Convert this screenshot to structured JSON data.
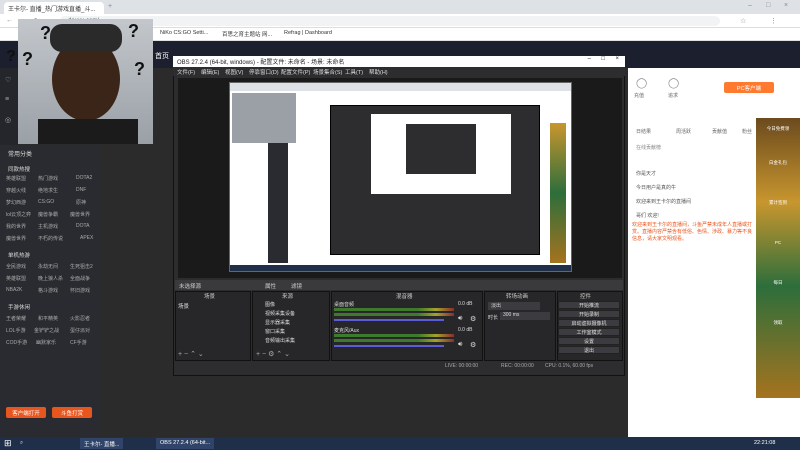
{
  "browser": {
    "tabs": [
      "王卡尔- 直播_热门游戏直播_斗..."
    ],
    "url": "douyu.com/...",
    "bookmarks": [
      "NiKo CS:GO Setti...",
      "百思之育主题站 网...",
      "Refrag | Dashboard"
    ]
  },
  "site": {
    "top_link": "首页",
    "left_menu": {
      "header": "常用分类",
      "section1": "同款热搜",
      "rows1": [
        [
          "英雄联盟",
          "热门游戏",
          "DOTA2"
        ],
        [
          "穿越火线",
          "绝地求生",
          "DNF"
        ],
        [
          "梦幻西游",
          "CS:GO",
          "原神"
        ],
        [
          "lol云顶之弈",
          "魔兽争霸",
          "魔兽世界"
        ],
        [
          "我的世界",
          "主机游戏",
          "DOTA"
        ],
        [
          "魔兽世界",
          "不朽的传说",
          "APEX"
        ]
      ],
      "section2": "单机热游",
      "rows2": [
        [
          "全民游戏",
          "永劫无间",
          "生死狙击2"
        ],
        [
          "英雄联盟",
          "晚上狼人杀",
          "全面战争"
        ],
        [
          "NBA2K",
          "格斗游戏",
          "怀旧游戏"
        ]
      ],
      "section3": "手游休闲",
      "rows3": [
        [
          "王者荣耀",
          "和平精英",
          "火影忍者"
        ],
        [
          "LOL手游",
          "金铲铲之战",
          "蛋仔派对"
        ],
        [
          "COD手游",
          "幽默家乐",
          "CF手游"
        ]
      ],
      "btn_a": "客户端打开",
      "btn_b": "斗鱼打赏"
    },
    "right": {
      "user_links": [
        "充值",
        "追求"
      ],
      "pc_badge": "PC客户端",
      "tabs": [
        "日结果",
        "周活跃",
        "贡献值",
        "粉丝"
      ],
      "gift_title": "在线贡献榜",
      "chat_lines": [
        "你是天才",
        "今日用户是真的牛",
        "欢迎来到王卡尔的直播间",
        "哥们 欢迎!",
        "最好的小嘟哥"
      ],
      "notice": "欢迎来到王卡尔的直播间，斗鱼严禁未成年人直播或打赏。直播内容严禁含有低俗、色情、涉政、暴力等不良信息，请大家文明观看。"
    },
    "promo": [
      "今日免费领",
      "白金礼包",
      "累计签到",
      "PC",
      "每日",
      "领取"
    ]
  },
  "obs": {
    "title": "OBS 27.2.4 (64-bit, windows) - 配置文件: 未命名 - 场景: 未命名",
    "menu": [
      "文件(F)",
      "编辑(E)",
      "视图(V)",
      "停靠窗口(D)",
      "配置文件(P)",
      "场景集合(S)",
      "工具(T)",
      "帮助(H)"
    ],
    "source_bar": "未选择源",
    "source_bar_btns": [
      "属性",
      "滤镜"
    ],
    "docks": [
      "场景",
      "来源",
      "混音器",
      "转场动画",
      "控件"
    ],
    "scene_item": "场景",
    "sources": [
      "图像",
      "视频采集设备",
      "显示器采集",
      "窗口采集",
      "音频输出采集"
    ],
    "mixer": [
      {
        "name": "桌面音频",
        "db": "0.0 dB"
      },
      {
        "name": "麦克风/Aux",
        "db": "0.0 dB"
      }
    ],
    "transition": {
      "type": "淡出",
      "duration_label": "时长",
      "duration": "300 ms"
    },
    "controls": [
      "开始推流",
      "开始录制",
      "启动虚拟摄像机",
      "工作室模式",
      "设置",
      "退出"
    ],
    "status": {
      "live": "LIVE: 00:00:00",
      "rec": "REC: 00:00:00",
      "cpu": "CPU: 0.1%, 60.00 fps"
    }
  },
  "taskbar": {
    "items": [
      "王卡尔- 直播...",
      "OBS 27.2.4 (64-bit..."
    ],
    "time": "22:21:08"
  },
  "colors": {
    "obs_bg": "#2d2d30",
    "taskbar": "#1f2f4a",
    "douyu_orange": "#ff7a2f"
  }
}
